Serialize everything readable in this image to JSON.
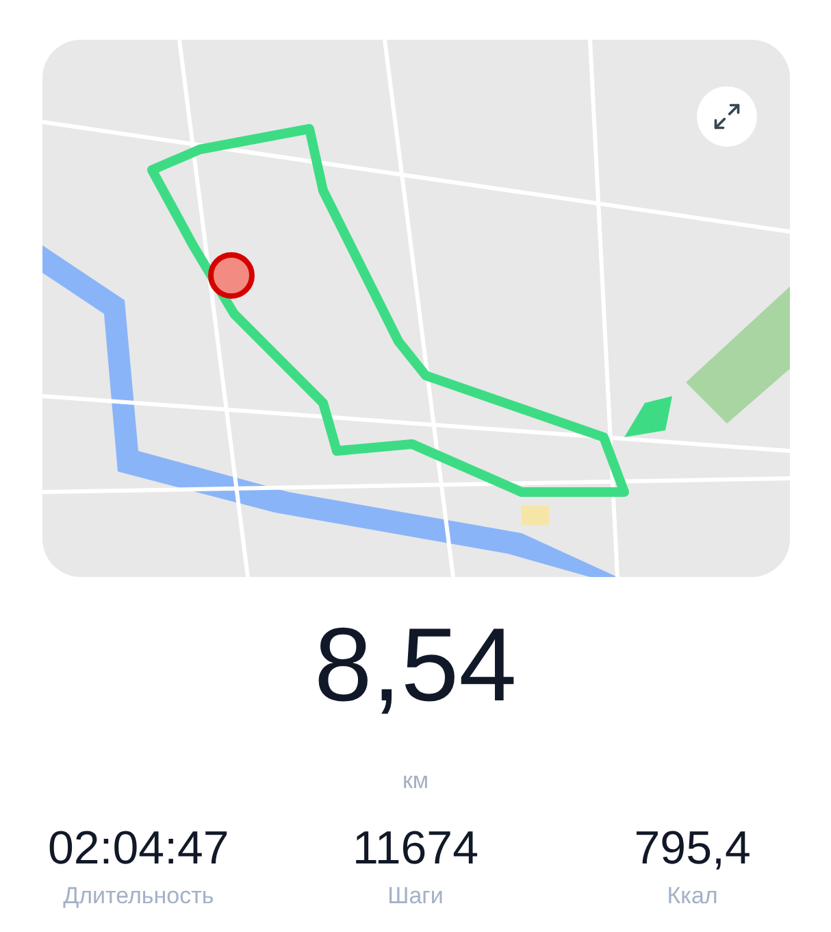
{
  "distance": {
    "value": "8,54",
    "unit": "км"
  },
  "stats": [
    {
      "value": "02:04:47",
      "label": "Длительность"
    },
    {
      "value": "11674",
      "label": "Шаги"
    },
    {
      "value": "795,4",
      "label": "Ккал"
    }
  ]
}
